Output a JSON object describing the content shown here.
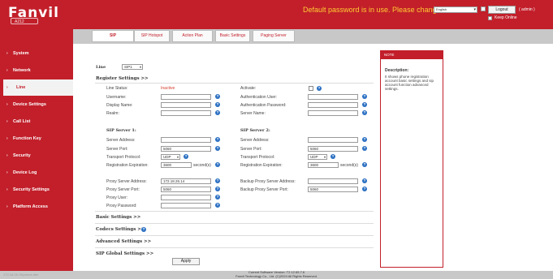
{
  "header": {
    "logo": "Fanvil",
    "model": "A212",
    "warning": "Default password is in use. Please change",
    "language": "English",
    "logout_label": "Logout",
    "user": "( admin )",
    "keep_online": "Keep Online"
  },
  "sidebar": {
    "items": [
      {
        "label": "System"
      },
      {
        "label": "Network"
      },
      {
        "label": "Line"
      },
      {
        "label": "Device Settings"
      },
      {
        "label": "Call List"
      },
      {
        "label": "Function Key"
      },
      {
        "label": "Security"
      },
      {
        "label": "Device Log"
      },
      {
        "label": "Security Settings"
      },
      {
        "label": "Platform Access"
      }
    ],
    "active_index": 2
  },
  "tabs": [
    {
      "label": "SIP"
    },
    {
      "label": "SIP Hotspot"
    },
    {
      "label": "Action Plan"
    },
    {
      "label": "Basic Settings"
    },
    {
      "label": "Paging Server"
    }
  ],
  "line": {
    "label": "Line",
    "value": "SIP1"
  },
  "register": {
    "title": "Register Settings >>",
    "line_status_label": "Line Status:",
    "line_status_value": "Inactive",
    "activate_label": "Activate:",
    "username_label": "Username:",
    "auth_user_label": "Authentication User:",
    "display_name_label": "Display Name:",
    "auth_password_label": "Authentication Password:",
    "realm_label": "Realm:",
    "server_name_label": "Server Name:"
  },
  "sip1": {
    "title": "SIP Server 1:",
    "address_label": "Server Address:",
    "address_value": "",
    "port_label": "Server Port:",
    "port_value": "5060",
    "transport_label": "Transport Protocol:",
    "transport_value": "UDP",
    "expiration_label": "Registration Expiration:",
    "expiration_value": "3600",
    "unit": "second(s)"
  },
  "sip2": {
    "title": "SIP Server 2:",
    "address_label": "Server Address:",
    "address_value": "",
    "port_label": "Server Port:",
    "port_value": "5060",
    "transport_label": "Transport Protocol:",
    "transport_value": "UDP",
    "expiration_label": "Registration Expiration:",
    "expiration_value": "3600",
    "unit": "second(s)"
  },
  "proxy": {
    "address_label": "Proxy Server Address:",
    "address_value": "172.18.26.14",
    "port_label": "Proxy Server Port:",
    "port_value": "5060",
    "user_label": "Proxy User:",
    "password_label": "Proxy Password:",
    "backup_address_label": "Backup Proxy Server Address:",
    "backup_port_label": "Backup Proxy Server Port:",
    "backup_port_value": "5060"
  },
  "sections": {
    "basic": "Basic Settings >>",
    "codecs": "Codecs Settings >>",
    "advanced": "Advanced Settings >>",
    "global": "SIP Global Settings >>"
  },
  "apply_label": "Apply",
  "note": {
    "header": "NOTE",
    "title": "Description:",
    "body": "It shows phone registration account basic settings and sip account function advanced settings."
  },
  "footer": {
    "ip": "172.18.26.76/phone.htm",
    "version": "Current Software Version: T2.12.65.7.6",
    "copyright": "Fanvil Technology Co., Ltd. (C)2024 All Rights Reserved."
  },
  "colors": {
    "brand": "#c21f2a",
    "warning": "#ffcc33",
    "help": "#2a6fc2",
    "inactive": "#d43a2a"
  }
}
